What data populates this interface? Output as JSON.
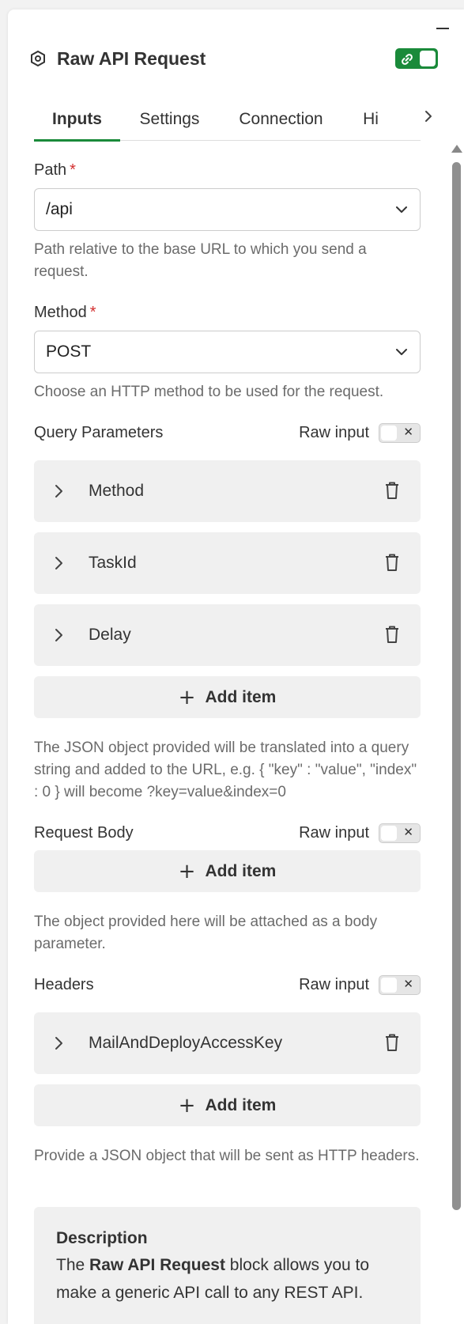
{
  "header": {
    "title": "Raw API Request"
  },
  "tabs": [
    {
      "label": "Inputs"
    },
    {
      "label": "Settings"
    },
    {
      "label": "Connection"
    },
    {
      "label": "Hi"
    }
  ],
  "path": {
    "label": "Path",
    "required": "*",
    "value": "/api",
    "hint": "Path relative to the base URL to which you send a request."
  },
  "method": {
    "label": "Method",
    "required": "*",
    "value": "POST",
    "hint": "Choose an HTTP method to be used for the request."
  },
  "query": {
    "label": "Query Parameters",
    "raw_label": "Raw input",
    "items": [
      {
        "name": "Method"
      },
      {
        "name": "TaskId"
      },
      {
        "name": "Delay"
      }
    ],
    "add_label": "Add item",
    "hint": "The JSON object provided will be translated into a query string and added to the URL, e.g. { \"key\" : \"value\", \"index\" : 0 } will become ?key=value&index=0"
  },
  "body": {
    "label": "Request Body",
    "raw_label": "Raw input",
    "add_label": "Add item",
    "hint": "The object provided here will be attached as a body parameter."
  },
  "headers": {
    "label": "Headers",
    "raw_label": "Raw input",
    "items": [
      {
        "name": "MailAndDeployAccessKey"
      }
    ],
    "add_label": "Add item",
    "hint": "Provide a JSON object that will be sent as HTTP headers."
  },
  "description": {
    "title": "Description",
    "prefix": "The ",
    "bold": "Raw API Request",
    "suffix": " block allows you to make a generic API call to any REST API."
  },
  "colors": {
    "accent": "#1a8a3a",
    "required": "#d32f2f"
  }
}
